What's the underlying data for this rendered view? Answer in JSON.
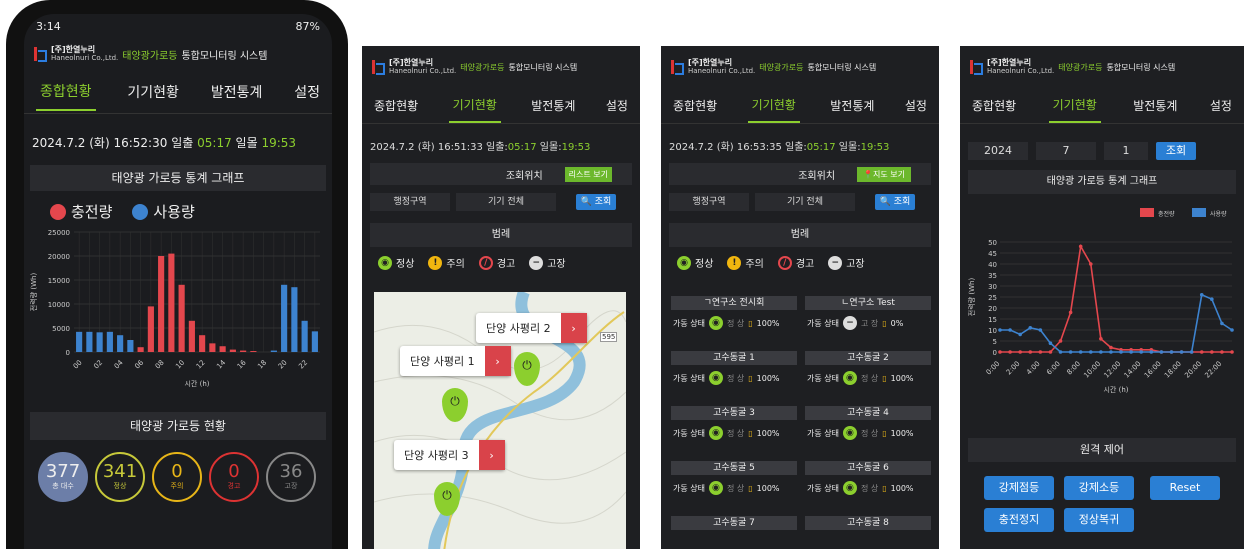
{
  "phone": {
    "status_time": "3:14",
    "status_right": "87%",
    "company_kr": "[주]한열누리",
    "company_en": "Haneolnuri Co.,Ltd.",
    "system_prefix": "태양광가로등",
    "system_suffix": "통합모니터링 시스템",
    "tabs": [
      "종합현황",
      "기기현황",
      "발전통계",
      "설정"
    ],
    "date": "2024.7.2 (화) 16:52:30",
    "sunrise_label": "일출",
    "sunrise": "05:17",
    "sunset_label": "일몰",
    "sunset": "19:53",
    "graph_title": "태양광 가로등 통계 그래프",
    "legend_charge": "충전량",
    "legend_use": "사용량",
    "status_title": "태양광 가로등 현황",
    "counts": [
      {
        "n": "377",
        "l": "총 대수",
        "color": "#6c7ea8"
      },
      {
        "n": "341",
        "l": "정상",
        "color": "#c7c93a"
      },
      {
        "n": "0",
        "l": "주의",
        "color": "#e7b518"
      },
      {
        "n": "0",
        "l": "경고",
        "color": "#d33"
      },
      {
        "n": "36",
        "l": "고장",
        "color": "#888"
      }
    ]
  },
  "chart_data": [
    {
      "type": "bar",
      "title": "",
      "xlabel": "시간 (h)",
      "ylabel": "전력량 (Wh)",
      "ylim": [
        0,
        25000
      ],
      "yticks": [
        "25000",
        "20000",
        "15000",
        "10000",
        "5000",
        "0"
      ],
      "xticks": [
        "00",
        "02",
        "04",
        "06",
        "08",
        "10",
        "12",
        "14",
        "16",
        "18",
        "20",
        "22"
      ],
      "categories": [
        "00",
        "01",
        "02",
        "03",
        "04",
        "05",
        "06",
        "07",
        "08",
        "09",
        "10",
        "11",
        "12",
        "13",
        "14",
        "15",
        "16",
        "17",
        "18",
        "19",
        "20",
        "21",
        "22",
        "23"
      ],
      "series": [
        {
          "name": "충전량",
          "color": "#e4474d",
          "values": [
            0,
            0,
            0,
            0,
            0,
            0,
            1000,
            9500,
            20000,
            20500,
            14000,
            6500,
            3500,
            1800,
            1200,
            500,
            300,
            200,
            0,
            0,
            0,
            0,
            0,
            0
          ]
        },
        {
          "name": "사용량",
          "color": "#3d83cf",
          "values": [
            4200,
            4200,
            4100,
            4200,
            3500,
            2500,
            0,
            0,
            0,
            0,
            0,
            0,
            0,
            0,
            0,
            0,
            0,
            0,
            0,
            300,
            14000,
            13500,
            6500,
            4300
          ]
        }
      ]
    },
    {
      "type": "line",
      "title": "",
      "xlabel": "시간 (h)",
      "ylabel": "전력량 (Wh)",
      "ylim": [
        0,
        50
      ],
      "yticks": [
        "50",
        "45",
        "40",
        "35",
        "30",
        "25",
        "20",
        "15",
        "10",
        "5",
        "0"
      ],
      "xticks": [
        "0:00",
        "2:00",
        "4:00",
        "6:00",
        "8:00",
        "10:00",
        "12:00",
        "14:00",
        "16:00",
        "18:00",
        "20:00",
        "22:00"
      ],
      "categories": [
        "0",
        "1",
        "2",
        "3",
        "4",
        "5",
        "6",
        "7",
        "8",
        "9",
        "10",
        "11",
        "12",
        "13",
        "14",
        "15",
        "16",
        "17",
        "18",
        "19",
        "20",
        "21",
        "22",
        "23"
      ],
      "series": [
        {
          "name": "충전량",
          "color": "#e4474d",
          "values": [
            0,
            0,
            0,
            0,
            0,
            0,
            5,
            18,
            48,
            40,
            6,
            2,
            1,
            1,
            1,
            1,
            0,
            0,
            0,
            0,
            0,
            0,
            0,
            0
          ]
        },
        {
          "name": "사용량",
          "color": "#3d83cf",
          "values": [
            10,
            10,
            8,
            11,
            10,
            4,
            0,
            0,
            0,
            0,
            0,
            0,
            0,
            0,
            0,
            0,
            0,
            0,
            0,
            0,
            26,
            24,
            13,
            10
          ]
        }
      ]
    }
  ],
  "p2": {
    "date": "2024.7.2 (화) 16:51:33",
    "sunrise": "05:17",
    "sunset": "19:53",
    "query_label": "조회위치",
    "list_btn": "리스트 보기",
    "region": "행정구역",
    "device": "기기 전체",
    "search": "조회",
    "legend_title": "범례",
    "legend": [
      "정상",
      "주의",
      "경고",
      "고장"
    ],
    "callouts": [
      "단양 사평리 2",
      "단양 사평리 1",
      "단양 사평리 3"
    ],
    "road_label": "595"
  },
  "p3": {
    "date": "2024.7.2 (화) 16:53:35",
    "sunrise": "05:17",
    "sunset": "19:53",
    "map_btn": "지도 보기",
    "items": [
      {
        "name": "ㄱ연구소 전시회",
        "state": "정 상",
        "pct": "100%"
      },
      {
        "name": "ㄴ연구소 Test",
        "state": "고 장",
        "pct": "0%"
      },
      {
        "name": "고수동굴 1",
        "state": "정 상",
        "pct": "100%"
      },
      {
        "name": "고수동굴 2",
        "state": "정 상",
        "pct": "100%"
      },
      {
        "name": "고수동굴 3",
        "state": "정 상",
        "pct": "100%"
      },
      {
        "name": "고수동굴 4",
        "state": "정 상",
        "pct": "100%"
      },
      {
        "name": "고수동굴 5",
        "state": "정 상",
        "pct": "100%"
      },
      {
        "name": "고수동굴 6",
        "state": "정 상",
        "pct": "100%"
      },
      {
        "name": "고수동굴 7",
        "state": "",
        "pct": ""
      },
      {
        "name": "고수동굴 8",
        "state": "",
        "pct": ""
      }
    ],
    "op_label": "가동 상태"
  },
  "p4": {
    "year": "2024",
    "month": "7",
    "day": "1",
    "search": "조회",
    "graph_title": "태양광 가로등 통계 그래프",
    "remote_title": "원격 제어",
    "buttons": [
      "강제점등",
      "강제소등",
      "Reset",
      "충전정지",
      "정상복귀"
    ]
  }
}
